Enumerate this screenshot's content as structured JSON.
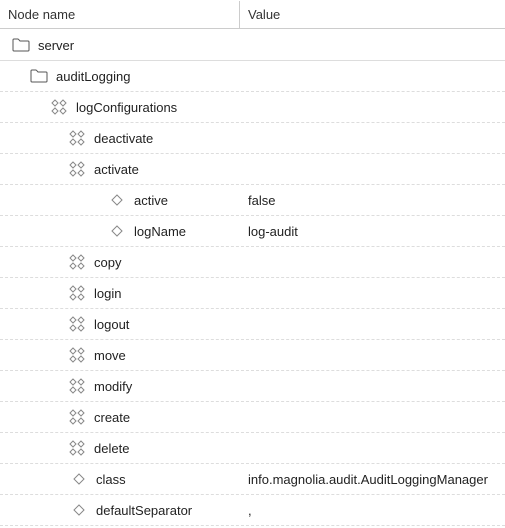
{
  "columns": {
    "name": "Node name",
    "value": "Value"
  },
  "rows": [
    {
      "indent": 12,
      "icon": "folder",
      "label": "server",
      "value": "",
      "solid": true
    },
    {
      "indent": 30,
      "icon": "folder",
      "label": "auditLogging",
      "value": ""
    },
    {
      "indent": 50,
      "icon": "content",
      "label": "logConfigurations",
      "value": ""
    },
    {
      "indent": 68,
      "icon": "content",
      "label": "deactivate",
      "value": ""
    },
    {
      "indent": 68,
      "icon": "content",
      "label": "activate",
      "value": ""
    },
    {
      "indent": 108,
      "icon": "prop",
      "label": "active",
      "value": "false"
    },
    {
      "indent": 108,
      "icon": "prop",
      "label": "logName",
      "value": "log-audit"
    },
    {
      "indent": 68,
      "icon": "content",
      "label": "copy",
      "value": ""
    },
    {
      "indent": 68,
      "icon": "content",
      "label": "login",
      "value": ""
    },
    {
      "indent": 68,
      "icon": "content",
      "label": "logout",
      "value": ""
    },
    {
      "indent": 68,
      "icon": "content",
      "label": "move",
      "value": ""
    },
    {
      "indent": 68,
      "icon": "content",
      "label": "modify",
      "value": ""
    },
    {
      "indent": 68,
      "icon": "content",
      "label": "create",
      "value": ""
    },
    {
      "indent": 68,
      "icon": "content",
      "label": "delete",
      "value": ""
    },
    {
      "indent": 70,
      "icon": "prop",
      "label": "class",
      "value": "info.magnolia.audit.AuditLoggingManager"
    },
    {
      "indent": 70,
      "icon": "prop",
      "label": "defaultSeparator",
      "value": ","
    }
  ]
}
